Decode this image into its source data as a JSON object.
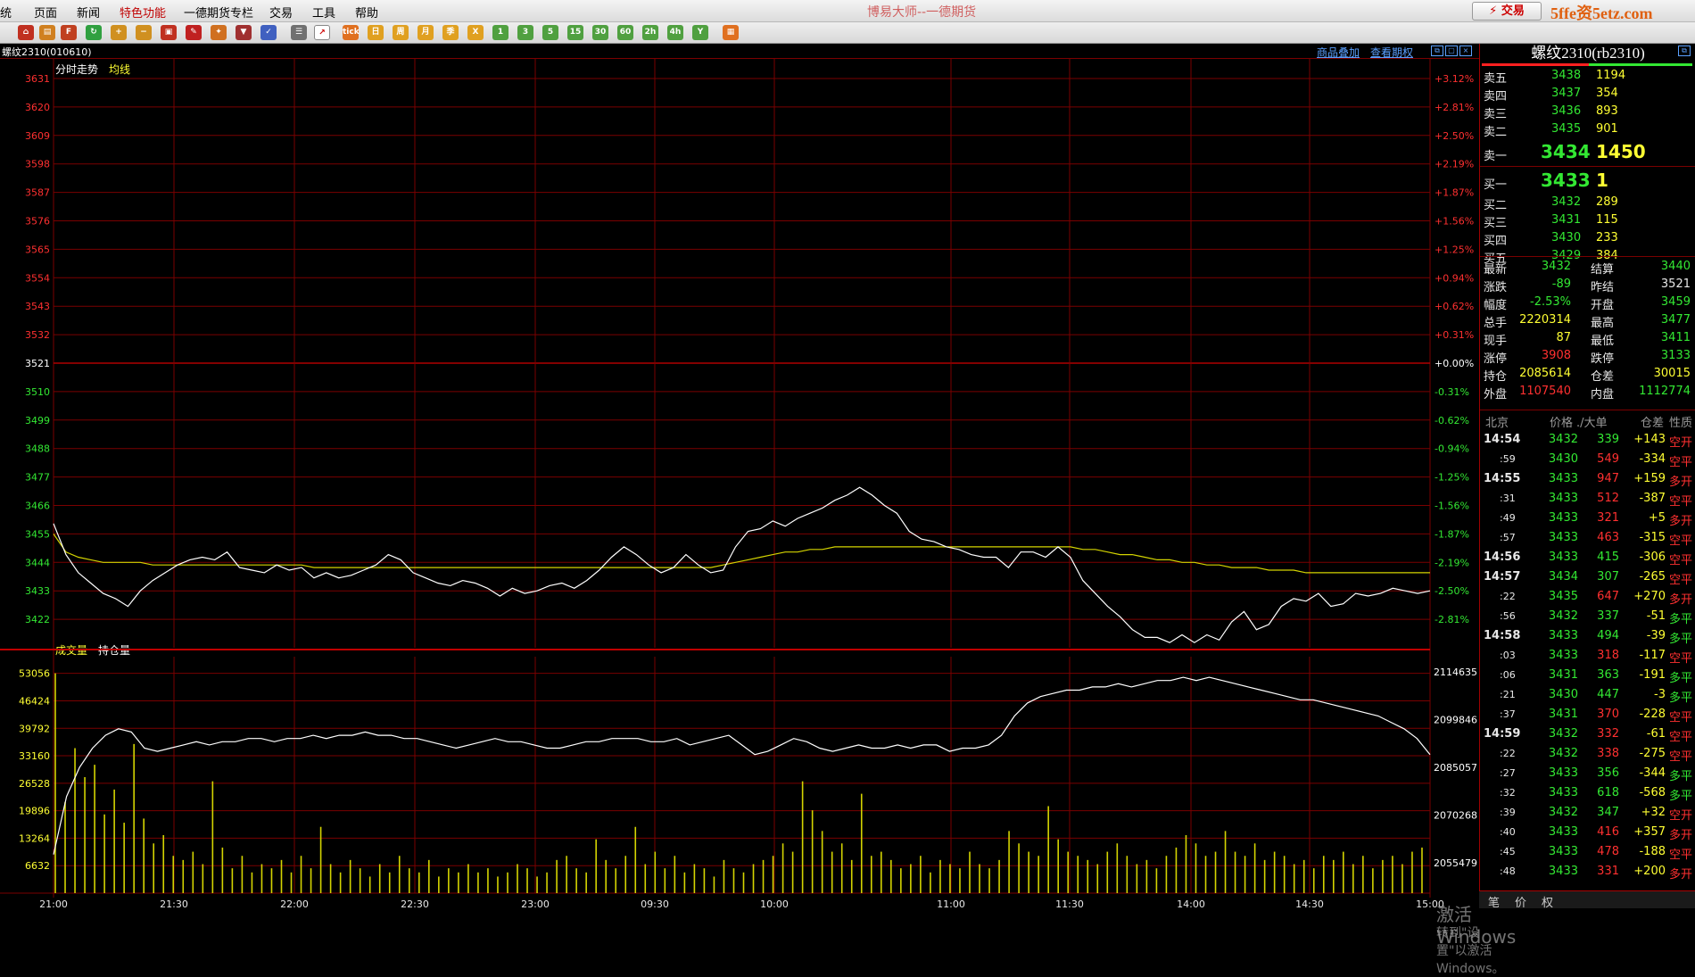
{
  "menu": [
    "统",
    "页面",
    "新闻",
    "特色功能",
    "一德期货专栏",
    "交易",
    "工具",
    "帮助"
  ],
  "app_title": "博易大师--一德期货",
  "trade_button": "⚡ 交易",
  "logo": "5ffe资5etz.com",
  "toolbar_labels": [
    "日",
    "周",
    "月",
    "季",
    "X",
    "1",
    "3",
    "5",
    "15",
    "30",
    "60",
    "2h",
    "4h",
    "Y"
  ],
  "infobar": {
    "symbol": "螺纹2310(010610)",
    "link1": "商品叠加",
    "link2": "查看期权"
  },
  "price_panel": {
    "tab1": "分时走势",
    "tab2": "均线"
  },
  "volume_panel": {
    "tab1": "成交量",
    "tab2": "持仓量"
  },
  "colors": {
    "grid": "#7a0000",
    "up": "#ff3030",
    "down": "#33e833",
    "avg": "#d4d400",
    "price": "#ffffff",
    "vol": "#d4d400"
  },
  "chart_data": [
    {
      "type": "line",
      "title": "",
      "y_ticks": [
        3631,
        3620,
        3609,
        3598,
        3587,
        3576,
        3565,
        3554,
        3543,
        3532,
        3521,
        3510,
        3499,
        3488,
        3477,
        3466,
        3455,
        3444,
        3433,
        3422
      ],
      "y_ticks_pct": [
        "+3.12%",
        "+2.81%",
        "+2.50%",
        "+2.19%",
        "+1.87%",
        "+1.56%",
        "+1.25%",
        "+0.94%",
        "+0.62%",
        "+0.31%",
        "+0.00%",
        "-0.31%",
        "-0.62%",
        "-0.94%",
        "-1.25%",
        "-1.56%",
        "-1.87%",
        "-2.19%",
        "-2.50%",
        "-2.81%"
      ],
      "ylim": [
        3411,
        3631
      ],
      "ref_price": 3521,
      "x_ticks": [
        "21:00",
        "21:30",
        "22:00",
        "22:30",
        "23:00",
        "09:30",
        "10:00",
        "11:00",
        "11:30",
        "14:00",
        "14:30",
        "15:00"
      ],
      "series": [
        {
          "name": "分时走势",
          "values": [
            3459,
            3447,
            3440,
            3436,
            3432,
            3430,
            3427,
            3433,
            3437,
            3440,
            3443,
            3445,
            3446,
            3445,
            3448,
            3442,
            3441,
            3440,
            3443,
            3441,
            3442,
            3438,
            3440,
            3438,
            3439,
            3441,
            3443,
            3447,
            3445,
            3440,
            3438,
            3436,
            3435,
            3437,
            3436,
            3434,
            3431,
            3434,
            3432,
            3433,
            3435,
            3436,
            3434,
            3437,
            3441,
            3446,
            3450,
            3447,
            3443,
            3440,
            3442,
            3447,
            3443,
            3440,
            3441,
            3450,
            3456,
            3457,
            3460,
            3458,
            3461,
            3463,
            3465,
            3468,
            3470,
            3473,
            3470,
            3466,
            3463,
            3456,
            3453,
            3452,
            3450,
            3449,
            3447,
            3446,
            3446,
            3442,
            3448,
            3448,
            3446,
            3450,
            3446,
            3437,
            3432,
            3427,
            3423,
            3418,
            3415,
            3415,
            3413,
            3416,
            3413,
            3416,
            3414,
            3421,
            3425,
            3418,
            3420,
            3427,
            3430,
            3429,
            3432,
            3427,
            3428,
            3432,
            3431,
            3432,
            3434,
            3433,
            3432,
            3433
          ]
        },
        {
          "name": "均线",
          "values": [
            3455,
            3448,
            3446,
            3445,
            3444,
            3444,
            3444,
            3444,
            3443,
            3443,
            3443,
            3443,
            3443,
            3443,
            3443,
            3443,
            3443,
            3443,
            3443,
            3443,
            3443,
            3442,
            3442,
            3442,
            3442,
            3442,
            3442,
            3442,
            3442,
            3442,
            3442,
            3442,
            3442,
            3442,
            3442,
            3442,
            3442,
            3442,
            3442,
            3442,
            3442,
            3442,
            3442,
            3442,
            3442,
            3442,
            3442,
            3442,
            3442,
            3442,
            3442,
            3442,
            3442,
            3442,
            3443,
            3444,
            3445,
            3446,
            3447,
            3448,
            3448,
            3449,
            3449,
            3450,
            3450,
            3450,
            3450,
            3450,
            3450,
            3450,
            3450,
            3450,
            3450,
            3450,
            3450,
            3450,
            3450,
            3450,
            3450,
            3450,
            3450,
            3450,
            3450,
            3449,
            3449,
            3448,
            3447,
            3447,
            3446,
            3445,
            3445,
            3444,
            3444,
            3443,
            3443,
            3442,
            3442,
            3442,
            3441,
            3441,
            3441,
            3440,
            3440,
            3440,
            3440,
            3440,
            3440,
            3440,
            3440,
            3440,
            3440,
            3440
          ]
        }
      ]
    },
    {
      "type": "bar",
      "y_ticks": [
        53056,
        46424,
        39792,
        33160,
        26528,
        19896,
        13264,
        6632
      ],
      "y2_ticks": [
        2114635,
        2099846,
        2085057,
        2070268,
        2055479
      ],
      "ylim": [
        0,
        56000
      ],
      "y2lim": [
        2046000,
        2118000
      ],
      "series": [
        {
          "name": "成交量",
          "values": [
            53056,
            22000,
            35000,
            28000,
            31000,
            19000,
            25000,
            17000,
            36000,
            18000,
            12000,
            14000,
            9000,
            8000,
            10000,
            7000,
            27000,
            11000,
            6000,
            9000,
            5000,
            7000,
            6000,
            8000,
            5000,
            9000,
            6000,
            16000,
            7000,
            5000,
            8000,
            6000,
            4000,
            7000,
            5000,
            9000,
            6000,
            5000,
            8000,
            4000,
            6000,
            5000,
            7000,
            5000,
            6000,
            4000,
            5000,
            7000,
            6000,
            4000,
            5000,
            8000,
            9000,
            6000,
            5000,
            13000,
            8000,
            6000,
            9000,
            16000,
            7000,
            10000,
            6000,
            9000,
            5000,
            7000,
            6000,
            4000,
            8000,
            6000,
            5000,
            7000,
            8000,
            9000,
            12000,
            10000,
            27000,
            20000,
            15000,
            10000,
            12000,
            8000,
            24000,
            9000,
            10000,
            8000,
            6000,
            7000,
            9000,
            5000,
            8000,
            7000,
            6000,
            10000,
            7000,
            6000,
            8000,
            15000,
            12000,
            10000,
            9000,
            21000,
            13000,
            10000,
            9000,
            8000,
            7000,
            10000,
            12000,
            9000,
            7000,
            8000,
            6000,
            9000,
            11000,
            14000,
            12000,
            9000,
            10000,
            15000,
            10000,
            9000,
            12000,
            8000,
            10000,
            9000,
            7000,
            8000,
            6000,
            9000,
            8000,
            10000,
            7000,
            9000,
            6000,
            8000,
            9000,
            7000,
            10000,
            11000
          ]
        },
        {
          "name": "持仓量",
          "values": [
            2058000,
            2076000,
            2085000,
            2091000,
            2095000,
            2097000,
            2096000,
            2091000,
            2090000,
            2091000,
            2092000,
            2093000,
            2092000,
            2093000,
            2093000,
            2094000,
            2094000,
            2093000,
            2094000,
            2094000,
            2095000,
            2094000,
            2095000,
            2095000,
            2096000,
            2095000,
            2095000,
            2094000,
            2094000,
            2093000,
            2092000,
            2091000,
            2092000,
            2093000,
            2094000,
            2093000,
            2093000,
            2092000,
            2091000,
            2091000,
            2092000,
            2093000,
            2093000,
            2094000,
            2094000,
            2094000,
            2093000,
            2093000,
            2094000,
            2092000,
            2093000,
            2094000,
            2095000,
            2092000,
            2089000,
            2090000,
            2092000,
            2094000,
            2093000,
            2091000,
            2090000,
            2091000,
            2092000,
            2091000,
            2091000,
            2092000,
            2091000,
            2092000,
            2092000,
            2090000,
            2091000,
            2091000,
            2092000,
            2095000,
            2101000,
            2105000,
            2107000,
            2108000,
            2109000,
            2109000,
            2110000,
            2110000,
            2111000,
            2110000,
            2111000,
            2112000,
            2112000,
            2113000,
            2112000,
            2113000,
            2112000,
            2111000,
            2110000,
            2109000,
            2108000,
            2107000,
            2106000,
            2106000,
            2105000,
            2104000,
            2103000,
            2102000,
            2101000,
            2099000,
            2097000,
            2094000,
            2089000
          ]
        }
      ]
    }
  ],
  "quote": {
    "title": "螺纹2310(rb2310)",
    "asks": [
      {
        "label": "卖五",
        "price": "3438",
        "vol": "1194"
      },
      {
        "label": "卖四",
        "price": "3437",
        "vol": "354"
      },
      {
        "label": "卖三",
        "price": "3436",
        "vol": "893"
      },
      {
        "label": "卖二",
        "price": "3435",
        "vol": "901"
      },
      {
        "label": "卖一",
        "price": "3434",
        "vol": "1450"
      }
    ],
    "bids": [
      {
        "label": "买一",
        "price": "3433",
        "vol": "1"
      },
      {
        "label": "买二",
        "price": "3432",
        "vol": "289"
      },
      {
        "label": "买三",
        "price": "3431",
        "vol": "115"
      },
      {
        "label": "买四",
        "price": "3430",
        "vol": "233"
      },
      {
        "label": "买五",
        "price": "3429",
        "vol": "384"
      }
    ],
    "stats": [
      {
        "l1": "最新",
        "v1": "3432",
        "c1": "g",
        "l2": "结算",
        "v2": "3440",
        "c2": "g"
      },
      {
        "l1": "涨跌",
        "v1": "-89",
        "c1": "g",
        "l2": "昨结",
        "v2": "3521",
        "c2": "w"
      },
      {
        "l1": "幅度",
        "v1": "-2.53%",
        "c1": "g",
        "l2": "开盘",
        "v2": "3459",
        "c2": "g"
      },
      {
        "l1": "总手",
        "v1": "2220314",
        "c1": "y",
        "l2": "最高",
        "v2": "3477",
        "c2": "g"
      },
      {
        "l1": "现手",
        "v1": "87",
        "c1": "y",
        "l2": "最低",
        "v2": "3411",
        "c2": "g"
      },
      {
        "l1": "涨停",
        "v1": "3908",
        "c1": "r",
        "l2": "跌停",
        "v2": "3133",
        "c2": "g"
      },
      {
        "l1": "持仓",
        "v1": "2085614",
        "c1": "y",
        "l2": "仓差",
        "v2": "30015",
        "c2": "y"
      },
      {
        "l1": "外盘",
        "v1": "1107540",
        "c1": "r",
        "l2": "内盘",
        "v2": "1112774",
        "c2": "g"
      }
    ],
    "ticks_header": {
      "time": "北京",
      "price": "价格",
      "vol": "./大单",
      "diff": "仓差",
      "nature": "性质"
    },
    "ticks": [
      {
        "t": "14:54",
        "bold": true,
        "p": "3432",
        "v": "339",
        "d": "+143",
        "n": "空开",
        "vc": "g",
        "dc": "y",
        "nc": "r"
      },
      {
        "t": ":59",
        "bold": false,
        "p": "3430",
        "v": "549",
        "d": "-334",
        "n": "空平",
        "vc": "r",
        "dc": "y",
        "nc": "r"
      },
      {
        "t": "14:55",
        "bold": true,
        "p": "3433",
        "v": "947",
        "d": "+159",
        "n": "多开",
        "vc": "r",
        "dc": "y",
        "nc": "r"
      },
      {
        "t": ":31",
        "bold": false,
        "p": "3433",
        "v": "512",
        "d": "-387",
        "n": "空平",
        "vc": "r",
        "dc": "y",
        "nc": "r"
      },
      {
        "t": ":49",
        "bold": false,
        "p": "3433",
        "v": "321",
        "d": "+5",
        "n": "多开",
        "vc": "r",
        "dc": "y",
        "nc": "r"
      },
      {
        "t": ":57",
        "bold": false,
        "p": "3433",
        "v": "463",
        "d": "-315",
        "n": "空平",
        "vc": "r",
        "dc": "y",
        "nc": "r"
      },
      {
        "t": "14:56",
        "bold": true,
        "p": "3433",
        "v": "415",
        "d": "-306",
        "n": "空平",
        "vc": "g",
        "dc": "y",
        "nc": "r"
      },
      {
        "t": "14:57",
        "bold": true,
        "p": "3434",
        "v": "307",
        "d": "-265",
        "n": "空平",
        "vc": "g",
        "dc": "y",
        "nc": "r"
      },
      {
        "t": ":22",
        "bold": false,
        "p": "3435",
        "v": "647",
        "d": "+270",
        "n": "多开",
        "vc": "r",
        "dc": "y",
        "nc": "r"
      },
      {
        "t": ":56",
        "bold": false,
        "p": "3432",
        "v": "337",
        "d": "-51",
        "n": "多平",
        "vc": "g",
        "dc": "y",
        "nc": "g"
      },
      {
        "t": "14:58",
        "bold": true,
        "p": "3433",
        "v": "494",
        "d": "-39",
        "n": "多平",
        "vc": "g",
        "dc": "y",
        "nc": "g"
      },
      {
        "t": ":03",
        "bold": false,
        "p": "3433",
        "v": "318",
        "d": "-117",
        "n": "空平",
        "vc": "r",
        "dc": "y",
        "nc": "r"
      },
      {
        "t": ":06",
        "bold": false,
        "p": "3431",
        "v": "363",
        "d": "-191",
        "n": "多平",
        "vc": "g",
        "dc": "y",
        "nc": "g"
      },
      {
        "t": ":21",
        "bold": false,
        "p": "3430",
        "v": "447",
        "d": "-3",
        "n": "多平",
        "vc": "g",
        "dc": "y",
        "nc": "g"
      },
      {
        "t": ":37",
        "bold": false,
        "p": "3431",
        "v": "370",
        "d": "-228",
        "n": "空平",
        "vc": "r",
        "dc": "y",
        "nc": "r"
      },
      {
        "t": "14:59",
        "bold": true,
        "p": "3432",
        "v": "332",
        "d": "-61",
        "n": "空平",
        "vc": "r",
        "dc": "y",
        "nc": "r"
      },
      {
        "t": ":22",
        "bold": false,
        "p": "3432",
        "v": "338",
        "d": "-275",
        "n": "空平",
        "vc": "r",
        "dc": "y",
        "nc": "r"
      },
      {
        "t": ":27",
        "bold": false,
        "p": "3433",
        "v": "356",
        "d": "-344",
        "n": "多平",
        "vc": "g",
        "dc": "y",
        "nc": "g"
      },
      {
        "t": ":32",
        "bold": false,
        "p": "3433",
        "v": "618",
        "d": "-568",
        "n": "多平",
        "vc": "g",
        "dc": "y",
        "nc": "g"
      },
      {
        "t": ":39",
        "bold": false,
        "p": "3432",
        "v": "347",
        "d": "+32",
        "n": "空开",
        "vc": "g",
        "dc": "y",
        "nc": "r"
      },
      {
        "t": ":40",
        "bold": false,
        "p": "3433",
        "v": "416",
        "d": "+357",
        "n": "多开",
        "vc": "r",
        "dc": "y",
        "nc": "r"
      },
      {
        "t": ":45",
        "bold": false,
        "p": "3433",
        "v": "478",
        "d": "-188",
        "n": "空平",
        "vc": "r",
        "dc": "y",
        "nc": "r"
      },
      {
        "t": ":48",
        "bold": false,
        "p": "3433",
        "v": "331",
        "d": "+200",
        "n": "多开",
        "vc": "r",
        "dc": "y",
        "nc": "r"
      }
    ],
    "tabs": [
      "笔",
      "价",
      "权"
    ]
  },
  "watermark": {
    "line1": "激活 Windows",
    "line2": "转到\"设置\"以激活 Windows。"
  }
}
